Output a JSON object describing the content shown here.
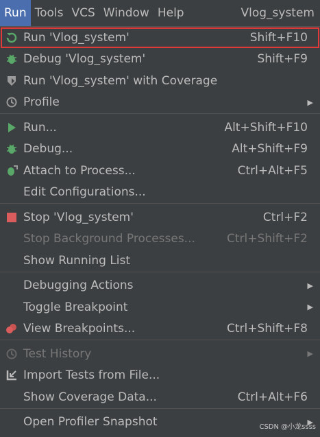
{
  "menubar": {
    "items": [
      "Run",
      "Tools",
      "VCS",
      "Window",
      "Help"
    ],
    "title": "Vlog_system"
  },
  "menu": {
    "rows": [
      {
        "label": "Run 'Vlog_system'",
        "shortcut": "Shift+F10",
        "icon": "rerun-icon"
      },
      {
        "label": "Debug 'Vlog_system'",
        "shortcut": "Shift+F9",
        "icon": "bug-icon"
      },
      {
        "label": "Run 'Vlog_system' with Coverage",
        "shortcut": "",
        "icon": "coverage-icon"
      },
      {
        "label": "Profile",
        "shortcut": "",
        "icon": "profile-icon",
        "submenu": true
      },
      {
        "label": "Run...",
        "shortcut": "Alt+Shift+F10",
        "icon": "run-icon"
      },
      {
        "label": "Debug...",
        "shortcut": "Alt+Shift+F9",
        "icon": "bug-icon"
      },
      {
        "label": "Attach to Process...",
        "shortcut": "Ctrl+Alt+F5",
        "icon": "attach-icon"
      },
      {
        "label": "Edit Configurations...",
        "shortcut": "",
        "icon": ""
      },
      {
        "label": "Stop 'Vlog_system'",
        "shortcut": "Ctrl+F2",
        "icon": "stop-icon"
      },
      {
        "label": "Stop Background Processes...",
        "shortcut": "Ctrl+Shift+F2",
        "icon": "",
        "disabled": true
      },
      {
        "label": "Show Running List",
        "shortcut": "",
        "icon": ""
      },
      {
        "label": "Debugging Actions",
        "shortcut": "",
        "icon": "",
        "submenu": true
      },
      {
        "label": "Toggle Breakpoint",
        "shortcut": "",
        "icon": "",
        "submenu": true
      },
      {
        "label": "View Breakpoints...",
        "shortcut": "Ctrl+Shift+F8",
        "icon": "breakpoints-icon"
      },
      {
        "label": "Test History",
        "shortcut": "",
        "icon": "history-icon",
        "submenu": true,
        "disabled": true
      },
      {
        "label": "Import Tests from File...",
        "shortcut": "",
        "icon": "import-icon"
      },
      {
        "label": "Show Coverage Data...",
        "shortcut": "Ctrl+Alt+F6",
        "icon": ""
      },
      {
        "label": "Open Profiler Snapshot",
        "shortcut": "",
        "icon": "",
        "submenu": true
      }
    ]
  },
  "watermark": "CSDN @小龙ssss",
  "colors": {
    "accent": "#4b6eaf",
    "highlight_border": "#e03a3a",
    "green": "#59a869",
    "red": "#db5c5c"
  }
}
